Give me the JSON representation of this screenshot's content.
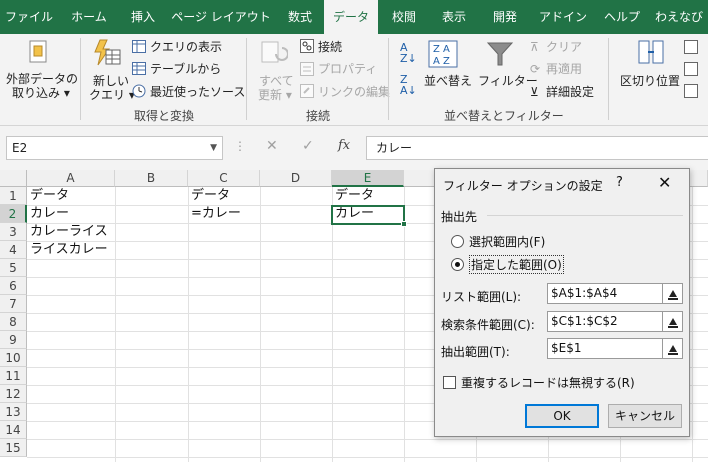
{
  "tabs": [
    "ファイル",
    "ホーム",
    "挿入",
    "ページ レイアウト",
    "数式",
    "データ",
    "校閲",
    "表示",
    "開発",
    "アドイン",
    "ヘルプ",
    "わえなび"
  ],
  "ribbon": {
    "get_data": {
      "line1": "外部データの",
      "line2": "取り込み ▾"
    },
    "new_query": {
      "line1": "新しい",
      "line2": "クエリ ▾"
    },
    "show_queries": "クエリの表示",
    "from_table": "テーブルから",
    "recent_sources": "最近使ったソース",
    "group_get_transform": "取得と変換",
    "refresh_all": {
      "line1": "すべて",
      "line2": "更新 ▾"
    },
    "connections": "接続",
    "properties": "プロパティ",
    "edit_links": "リンクの編集",
    "group_connections": "接続",
    "sort_label": "並べ替え",
    "filter_label": "フィルター",
    "clear": "クリア",
    "reapply": "再適用",
    "advanced": "詳細設定",
    "group_sort_filter": "並べ替えとフィルター",
    "text_to_columns": "区切り位置"
  },
  "formula_bar": {
    "name_box": "E2",
    "fx": "fx",
    "content": "カレー"
  },
  "grid": {
    "columns": [
      "A",
      "B",
      "C",
      "D",
      "E"
    ],
    "rows": [
      "1",
      "2",
      "3",
      "4",
      "5",
      "6",
      "7",
      "8",
      "9",
      "10",
      "11",
      "12",
      "13",
      "14",
      "15"
    ],
    "cells": {
      "A1": "データ",
      "A2": "カレー",
      "A3": "カレーライス",
      "A4": "ライスカレー",
      "C1": "データ",
      "C2": "=カレー",
      "E1": "データ",
      "E2": "カレー"
    }
  },
  "dialog": {
    "title": "フィルター オプションの設定",
    "help": "?",
    "close": "✕",
    "group_label": "抽出先",
    "radio_in_place": "選択範囲内(F)",
    "radio_copy": "指定した範囲(O)",
    "list_range_label": "リスト範囲(L):",
    "list_range_value": "$A$1:$A$4",
    "criteria_label": "検索条件範囲(C):",
    "criteria_value": "$C$1:$C$2",
    "copy_to_label": "抽出範囲(T):",
    "copy_to_value": "$E$1",
    "unique_label": "重複するレコードは無視する(R)",
    "ok": "OK",
    "cancel": "キャンセル"
  }
}
